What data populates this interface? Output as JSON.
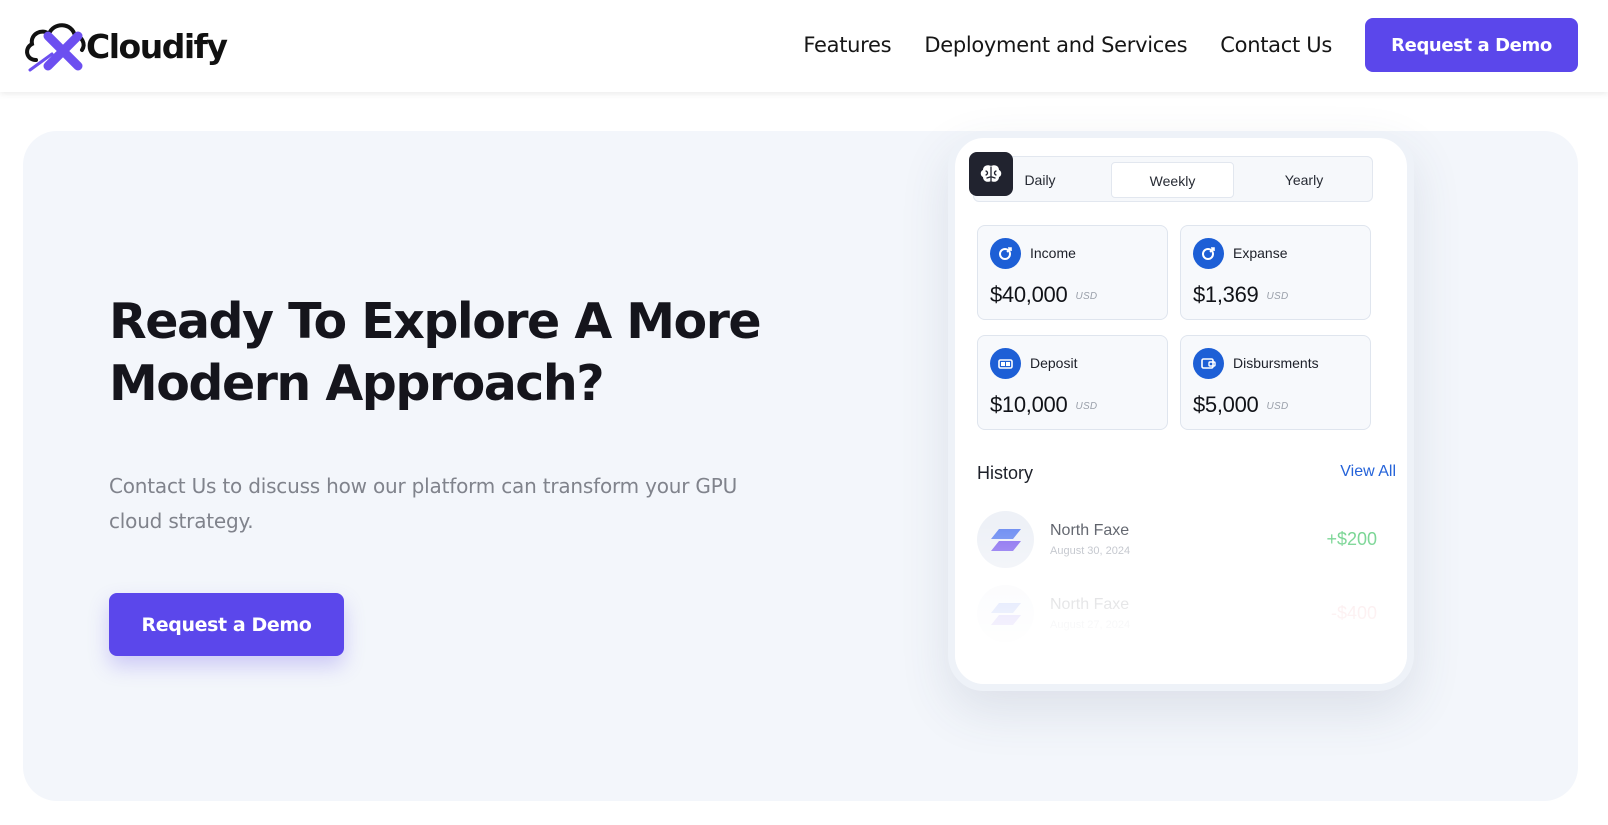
{
  "header": {
    "logo_text": "Cloudify",
    "logo_mark": "X",
    "nav": [
      "Features",
      "Deployment and Services",
      "Contact Us"
    ],
    "cta_label": "Request a Demo"
  },
  "hero": {
    "headline": "Ready To Explore A More Modern Approach?",
    "subtext": "Contact Us to discuss how our platform can transform your GPU cloud strategy.",
    "cta_label": "Request a Demo"
  },
  "dashboard": {
    "tabs": [
      "Daily",
      "Weekly",
      "Yearly"
    ],
    "active_tab": "Weekly",
    "stats": [
      {
        "label": "Income",
        "value": "$40,000",
        "unit": "USD",
        "icon": "income-icon"
      },
      {
        "label": "Expanse",
        "value": "$1,369",
        "unit": "USD",
        "icon": "expense-icon"
      },
      {
        "label": "Deposit",
        "value": "$10,000",
        "unit": "USD",
        "icon": "deposit-icon"
      },
      {
        "label": "Disbursments",
        "value": "$5,000",
        "unit": "USD",
        "icon": "disbursement-icon"
      }
    ],
    "history_title": "History",
    "view_all": "View All",
    "transactions": [
      {
        "name": "North Faxe",
        "date": "August 30, 2024",
        "amount": "+$200"
      },
      {
        "name": "North Faxe",
        "date": "August 27, 2024",
        "amount": "-$400"
      }
    ]
  },
  "colors": {
    "brand": "#5b47eb",
    "stat_icon": "#1d5fd6",
    "positive": "#6fd28c",
    "negative": "#f09aa0",
    "hero_bg": "#f3f6fb"
  }
}
